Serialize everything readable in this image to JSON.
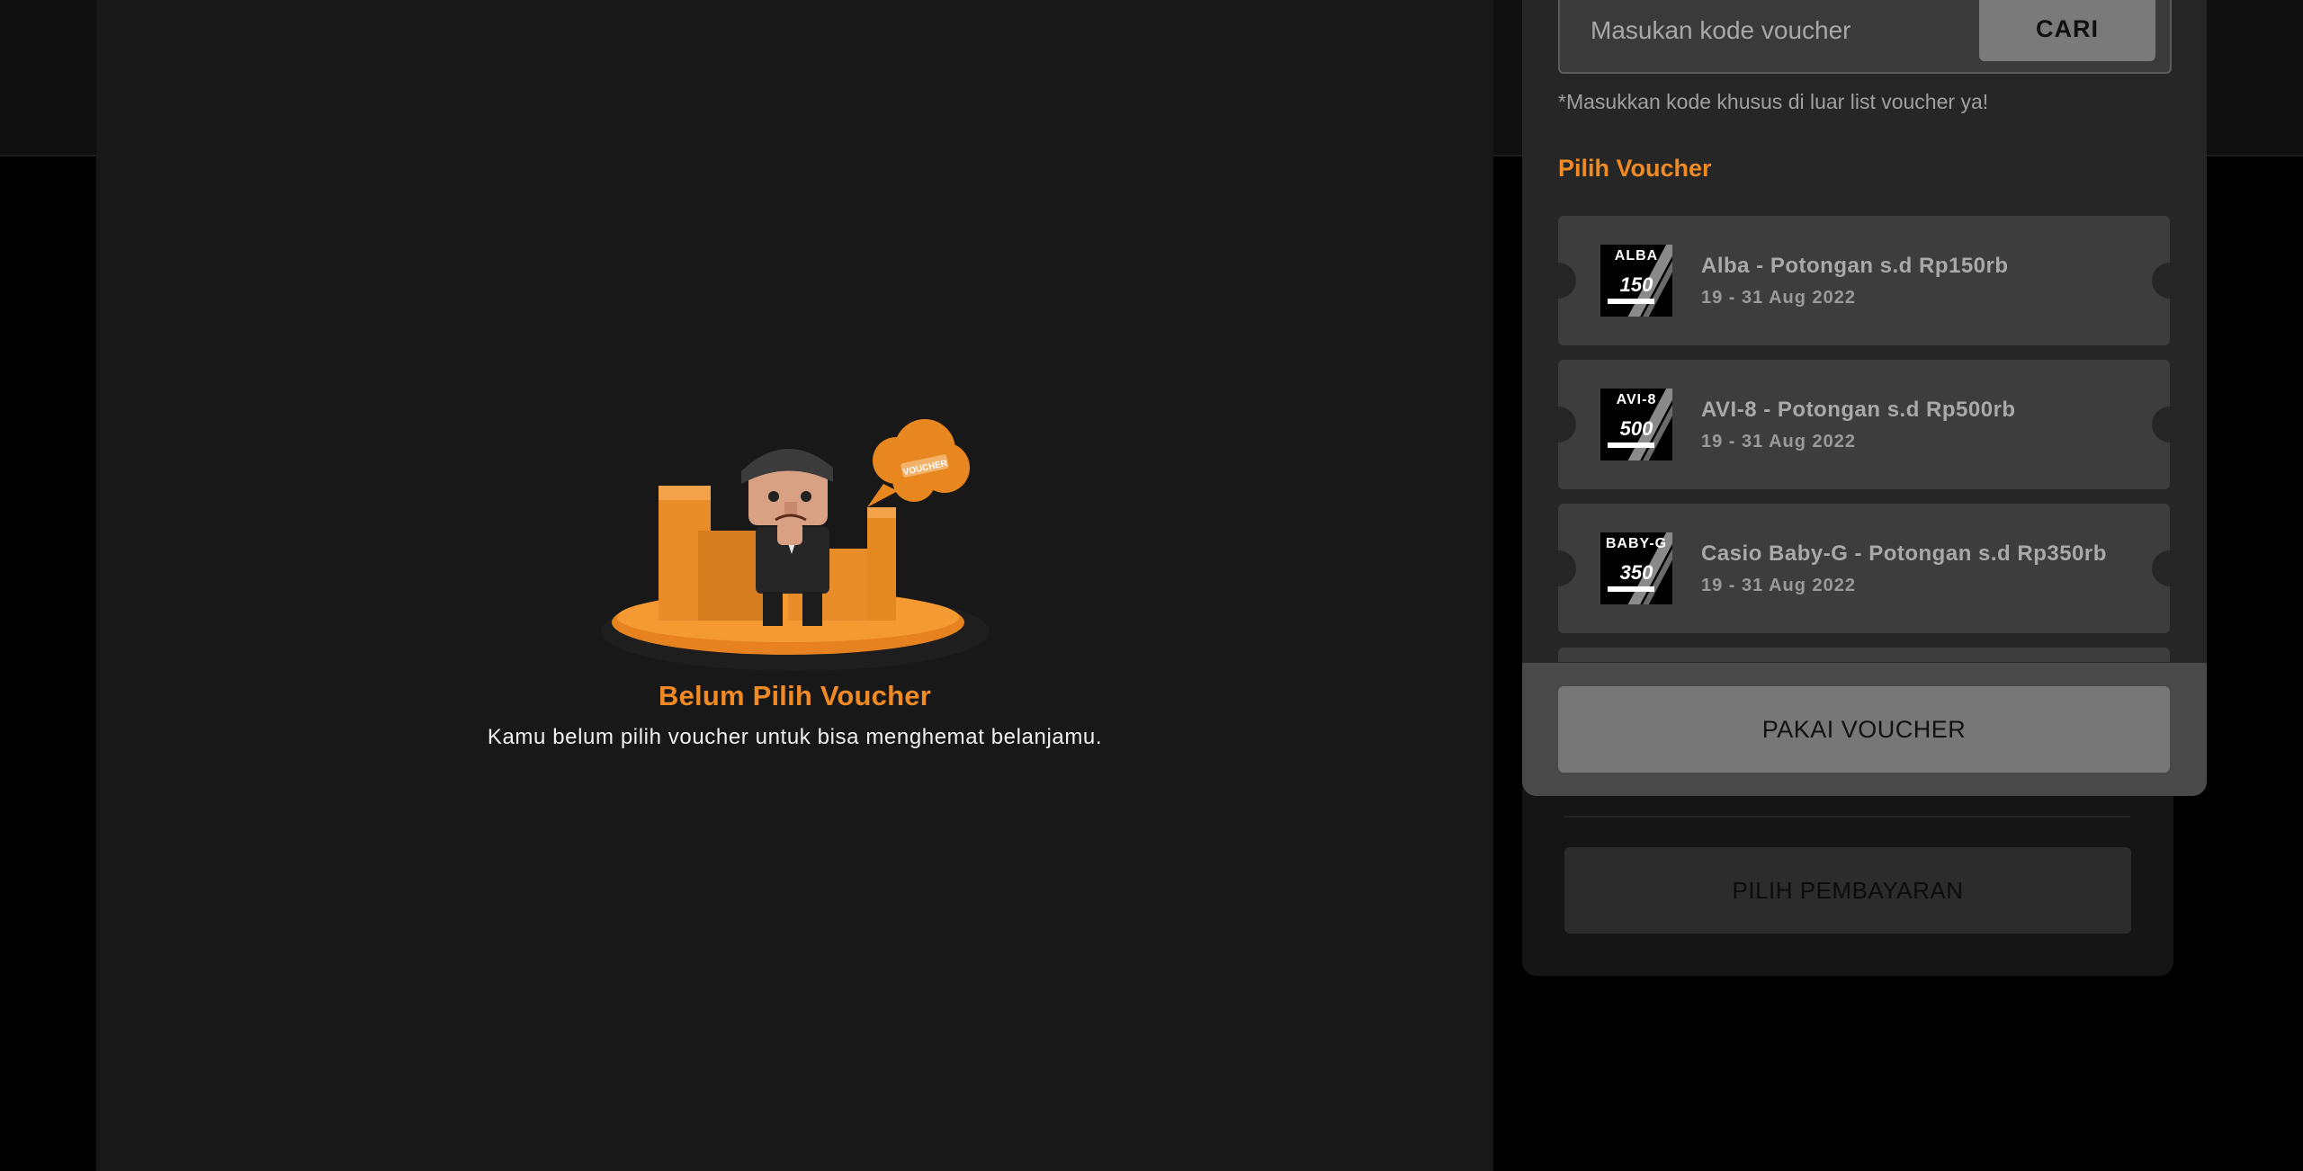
{
  "empty_state": {
    "title": "Belum Pilih Voucher",
    "description": "Kamu belum pilih voucher untuk bisa menghemat belanjamu.",
    "bubble_text": "VOUCHER"
  },
  "voucher_modal": {
    "search": {
      "placeholder": "Masukan kode voucher",
      "button_label": "CARI"
    },
    "hint": "*Masukkan kode khusus di luar list voucher ya!",
    "section_title": "Pilih Voucher",
    "vouchers": [
      {
        "brand": "ALBA",
        "amount": "150",
        "title": "Alba - Potongan s.d Rp150rb",
        "date": "19 - 31 Aug 2022"
      },
      {
        "brand": "AVI-8",
        "amount": "500",
        "title": "AVI-8 - Potongan s.d Rp500rb",
        "date": "19 - 31 Aug 2022"
      },
      {
        "brand": "BABY-G",
        "amount": "350",
        "title": "Casio Baby-G - Potongan s.d Rp350rb",
        "date": "19 - 31 Aug 2022"
      }
    ],
    "submit_label": "PAKAI VOUCHER"
  },
  "behind": {
    "pay_button_label": "PILIH PEMBAYARAN"
  },
  "colors": {
    "accent": "#f08a25",
    "page_bg": "#000000",
    "panel_bg": "#181819",
    "modal_bg": "#262626",
    "card_bg": "#3d3d3d"
  }
}
